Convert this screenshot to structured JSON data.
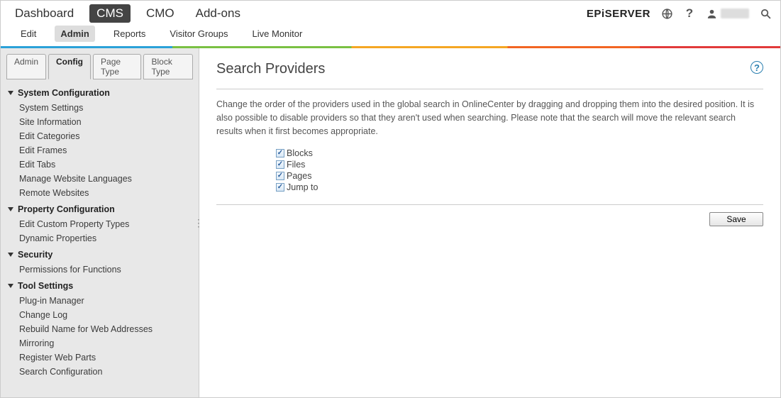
{
  "topnav": {
    "items": [
      {
        "label": "Dashboard",
        "active": false
      },
      {
        "label": "CMS",
        "active": true
      },
      {
        "label": "CMO",
        "active": false
      },
      {
        "label": "Add-ons",
        "active": false
      }
    ]
  },
  "brand": "EPiSERVER",
  "subnav": {
    "items": [
      {
        "label": "Edit",
        "active": false
      },
      {
        "label": "Admin",
        "active": true
      },
      {
        "label": "Reports",
        "active": false
      },
      {
        "label": "Visitor Groups",
        "active": false
      },
      {
        "label": "Live Monitor",
        "active": false
      }
    ]
  },
  "sidebar": {
    "tabs": [
      {
        "label": "Admin",
        "active": false
      },
      {
        "label": "Config",
        "active": true
      },
      {
        "label": "Page Type",
        "active": false
      },
      {
        "label": "Block Type",
        "active": false
      }
    ],
    "sections": [
      {
        "title": "System Configuration",
        "items": [
          "System Settings",
          "Site Information",
          "Edit Categories",
          "Edit Frames",
          "Edit Tabs",
          "Manage Website Languages",
          "Remote Websites"
        ]
      },
      {
        "title": "Property Configuration",
        "items": [
          "Edit Custom Property Types",
          "Dynamic Properties"
        ]
      },
      {
        "title": "Security",
        "items": [
          "Permissions for Functions"
        ]
      },
      {
        "title": "Tool Settings",
        "items": [
          "Plug-in Manager",
          "Change Log",
          "Rebuild Name for Web Addresses",
          "Mirroring",
          "Register Web Parts",
          "Search Configuration"
        ]
      }
    ]
  },
  "page": {
    "title": "Search Providers",
    "description": "Change the order of the providers used in the global search in OnlineCenter by dragging and dropping them into the desired position. It is also possible to disable providers so that they aren't used when searching. Please note that the search will move the relevant search results when it first becomes appropriate.",
    "providers": [
      {
        "label": "Blocks",
        "checked": true
      },
      {
        "label": "Files",
        "checked": true
      },
      {
        "label": "Pages",
        "checked": true
      },
      {
        "label": "Jump to",
        "checked": true
      }
    ],
    "saveLabel": "Save"
  },
  "icons": {
    "globe": "globe-icon",
    "help": "?",
    "user": "user-icon",
    "search": "search-icon"
  }
}
